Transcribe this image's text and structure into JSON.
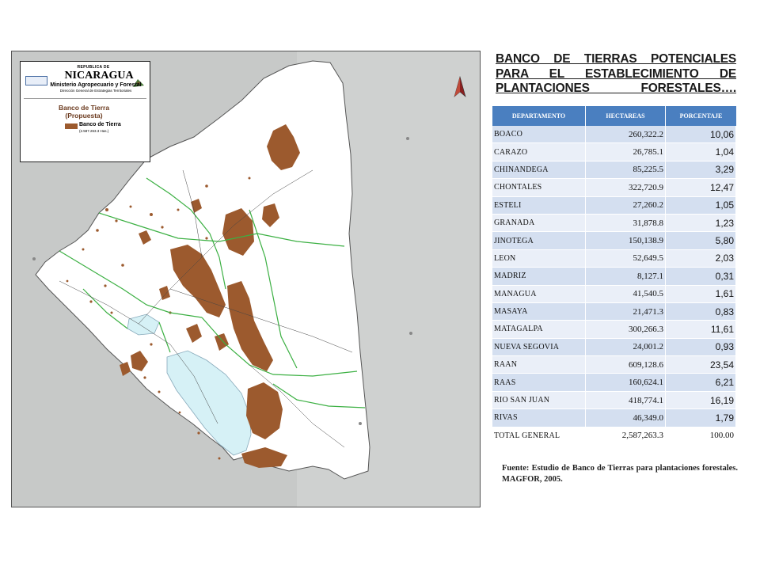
{
  "title": "BANCO DE TIERRAS POTENCIALES PARA EL ESTABLECIMIENTO DE PLANTACIONES FORESTALES….",
  "colors": {
    "land_bank": "#9c5a2e",
    "table_header": "#4a7fc0",
    "row_odd": "#d4dff0",
    "row_even": "#eaeff8",
    "roads": "#3cb043",
    "lake": "#d6f1f6"
  },
  "map": {
    "legend": {
      "republic": "REPUBLICA DE",
      "country": "NICARAGUA",
      "ministry": "Ministerio Agropecuario y Forestal",
      "direction": "Dirección General de Estrategias Territoriales",
      "map_title": "Banco de Tierra",
      "map_subtitle": "(Propuesta)",
      "legend_item": "Banco de Tierra",
      "legend_sub": "(2.587.263.3 Has.)"
    },
    "north_arrow_icon": "north-arrow-icon"
  },
  "table": {
    "headers": [
      "DEPARTAMENTO",
      "HECTAREAS",
      "PORCENTAJE"
    ],
    "rows": [
      {
        "dep": "BOACO",
        "hec": "260,322.2",
        "por": "10,06"
      },
      {
        "dep": "CARAZO",
        "hec": "26,785.1",
        "por": "1,04"
      },
      {
        "dep": "CHINANDEGA",
        "hec": "85,225.5",
        "por": "3,29"
      },
      {
        "dep": "CHONTALES",
        "hec": "322,720.9",
        "por": "12,47"
      },
      {
        "dep": "ESTELI",
        "hec": "27,260.2",
        "por": "1,05"
      },
      {
        "dep": "GRANADA",
        "hec": "31,878.8",
        "por": "1,23"
      },
      {
        "dep": "JINOTEGA",
        "hec": "150,138.9",
        "por": "5,80"
      },
      {
        "dep": "LEON",
        "hec": "52,649.5",
        "por": "2,03"
      },
      {
        "dep": "MADRIZ",
        "hec": "8,127.1",
        "por": "0,31"
      },
      {
        "dep": "MANAGUA",
        "hec": "41,540.5",
        "por": "1,61"
      },
      {
        "dep": "MASAYA",
        "hec": "21,471.3",
        "por": "0,83"
      },
      {
        "dep": "MATAGALPA",
        "hec": "300,266.3",
        "por": "11,61"
      },
      {
        "dep": "NUEVA SEGOVIA",
        "hec": "24,001.2",
        "por": "0,93"
      },
      {
        "dep": "RAAN",
        "hec": "609,128.6",
        "por": "23,54"
      },
      {
        "dep": "RAAS",
        "hec": "160,624.1",
        "por": "6,21"
      },
      {
        "dep": "RIO SAN JUAN",
        "hec": "418,774.1",
        "por": "16,19"
      },
      {
        "dep": "RIVAS",
        "hec": "46,349.0",
        "por": "1,79"
      }
    ],
    "total": {
      "dep": "TOTAL GENERAL",
      "hec": "2,587,263.3",
      "por": "100.00"
    }
  },
  "source": "Fuente: Estudio de Banco de Tierras para plantaciones forestales. MAGFOR, 2005."
}
